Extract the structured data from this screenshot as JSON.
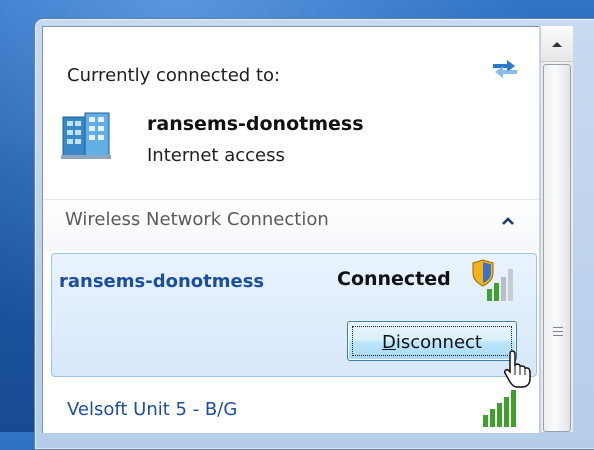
{
  "flyout": {
    "header": "Currently connected to:",
    "connected_network": {
      "name": "ransems-donotmess",
      "access": "Internet access"
    },
    "section": {
      "title": "Wireless Network Connection",
      "collapse_icon": "chevron-up-icon"
    },
    "networks": [
      {
        "name": "ransems-donotmess",
        "status": "Connected",
        "signal": "signal-secured-icon",
        "action_label": "Disconnect",
        "action_access_key": "D",
        "action_rest": "isconnect"
      },
      {
        "name": "Velsoft Unit 5 - B/G",
        "signal": "signal-full-icon"
      }
    ]
  },
  "colors": {
    "link_blue": "#1b4f9e",
    "selection_border": "#9ec4ec",
    "selection_fill": "#dceafb",
    "signal_green": "#3fa12c"
  }
}
